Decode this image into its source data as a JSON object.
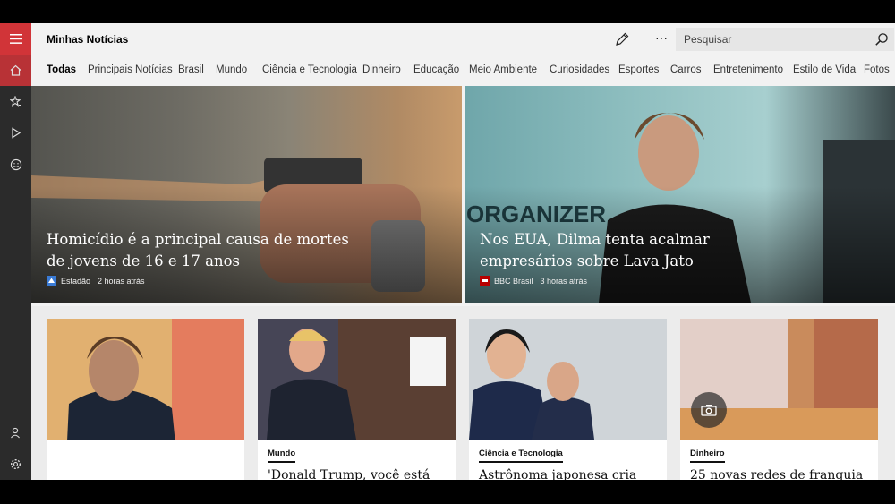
{
  "app": {
    "title": "Minhas Notícias"
  },
  "search": {
    "placeholder": "Pesquisar"
  },
  "toolbar": {
    "more_label": "···"
  },
  "tabs": [
    {
      "label": "Todas",
      "active": true
    },
    {
      "label": "Principais Notícias"
    },
    {
      "label": "Brasil"
    },
    {
      "label": "Mundo"
    },
    {
      "label": "Ciência e Tecnologia"
    },
    {
      "label": "Dinheiro"
    },
    {
      "label": "Educação"
    },
    {
      "label": "Meio Ambiente"
    },
    {
      "label": "Curiosidades"
    },
    {
      "label": "Esportes"
    },
    {
      "label": "Carros"
    },
    {
      "label": "Entretenimento"
    },
    {
      "label": "Estilo de Vida"
    },
    {
      "label": "Fotos"
    }
  ],
  "hero": [
    {
      "headline": "Homicídio é a principal causa de mortes de jovens de 16 e 17 anos",
      "source": "Estadão",
      "time": "2 horas atrás"
    },
    {
      "headline": "Nos EUA, Dilma tenta acalmar empresários sobre Lava Jato",
      "source": "BBC Brasil",
      "time": "3 horas atrás"
    }
  ],
  "cards": [
    {
      "category": "",
      "headline": ""
    },
    {
      "category": "Mundo",
      "headline": "'Donald Trump, você está"
    },
    {
      "category": "Ciência e Tecnologia",
      "headline": "Astrônoma japonesa cria"
    },
    {
      "category": "Dinheiro",
      "headline": "25 novas redes de franquia"
    }
  ],
  "colors": {
    "accent": "#d13438",
    "rail": "#2b2b2b"
  }
}
